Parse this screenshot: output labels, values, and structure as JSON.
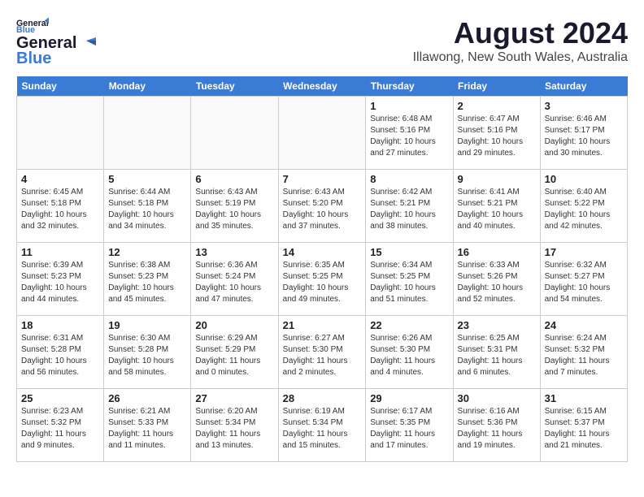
{
  "header": {
    "logo_line1": "General",
    "logo_line2": "Blue",
    "month_year": "August 2024",
    "location": "Illawong, New South Wales, Australia"
  },
  "days_of_week": [
    "Sunday",
    "Monday",
    "Tuesday",
    "Wednesday",
    "Thursday",
    "Friday",
    "Saturday"
  ],
  "weeks": [
    [
      {
        "day": "",
        "info": ""
      },
      {
        "day": "",
        "info": ""
      },
      {
        "day": "",
        "info": ""
      },
      {
        "day": "",
        "info": ""
      },
      {
        "day": "1",
        "info": "Sunrise: 6:48 AM\nSunset: 5:16 PM\nDaylight: 10 hours\nand 27 minutes."
      },
      {
        "day": "2",
        "info": "Sunrise: 6:47 AM\nSunset: 5:16 PM\nDaylight: 10 hours\nand 29 minutes."
      },
      {
        "day": "3",
        "info": "Sunrise: 6:46 AM\nSunset: 5:17 PM\nDaylight: 10 hours\nand 30 minutes."
      }
    ],
    [
      {
        "day": "4",
        "info": "Sunrise: 6:45 AM\nSunset: 5:18 PM\nDaylight: 10 hours\nand 32 minutes."
      },
      {
        "day": "5",
        "info": "Sunrise: 6:44 AM\nSunset: 5:18 PM\nDaylight: 10 hours\nand 34 minutes."
      },
      {
        "day": "6",
        "info": "Sunrise: 6:43 AM\nSunset: 5:19 PM\nDaylight: 10 hours\nand 35 minutes."
      },
      {
        "day": "7",
        "info": "Sunrise: 6:43 AM\nSunset: 5:20 PM\nDaylight: 10 hours\nand 37 minutes."
      },
      {
        "day": "8",
        "info": "Sunrise: 6:42 AM\nSunset: 5:21 PM\nDaylight: 10 hours\nand 38 minutes."
      },
      {
        "day": "9",
        "info": "Sunrise: 6:41 AM\nSunset: 5:21 PM\nDaylight: 10 hours\nand 40 minutes."
      },
      {
        "day": "10",
        "info": "Sunrise: 6:40 AM\nSunset: 5:22 PM\nDaylight: 10 hours\nand 42 minutes."
      }
    ],
    [
      {
        "day": "11",
        "info": "Sunrise: 6:39 AM\nSunset: 5:23 PM\nDaylight: 10 hours\nand 44 minutes."
      },
      {
        "day": "12",
        "info": "Sunrise: 6:38 AM\nSunset: 5:23 PM\nDaylight: 10 hours\nand 45 minutes."
      },
      {
        "day": "13",
        "info": "Sunrise: 6:36 AM\nSunset: 5:24 PM\nDaylight: 10 hours\nand 47 minutes."
      },
      {
        "day": "14",
        "info": "Sunrise: 6:35 AM\nSunset: 5:25 PM\nDaylight: 10 hours\nand 49 minutes."
      },
      {
        "day": "15",
        "info": "Sunrise: 6:34 AM\nSunset: 5:25 PM\nDaylight: 10 hours\nand 51 minutes."
      },
      {
        "day": "16",
        "info": "Sunrise: 6:33 AM\nSunset: 5:26 PM\nDaylight: 10 hours\nand 52 minutes."
      },
      {
        "day": "17",
        "info": "Sunrise: 6:32 AM\nSunset: 5:27 PM\nDaylight: 10 hours\nand 54 minutes."
      }
    ],
    [
      {
        "day": "18",
        "info": "Sunrise: 6:31 AM\nSunset: 5:28 PM\nDaylight: 10 hours\nand 56 minutes."
      },
      {
        "day": "19",
        "info": "Sunrise: 6:30 AM\nSunset: 5:28 PM\nDaylight: 10 hours\nand 58 minutes."
      },
      {
        "day": "20",
        "info": "Sunrise: 6:29 AM\nSunset: 5:29 PM\nDaylight: 11 hours\nand 0 minutes."
      },
      {
        "day": "21",
        "info": "Sunrise: 6:27 AM\nSunset: 5:30 PM\nDaylight: 11 hours\nand 2 minutes."
      },
      {
        "day": "22",
        "info": "Sunrise: 6:26 AM\nSunset: 5:30 PM\nDaylight: 11 hours\nand 4 minutes."
      },
      {
        "day": "23",
        "info": "Sunrise: 6:25 AM\nSunset: 5:31 PM\nDaylight: 11 hours\nand 6 minutes."
      },
      {
        "day": "24",
        "info": "Sunrise: 6:24 AM\nSunset: 5:32 PM\nDaylight: 11 hours\nand 7 minutes."
      }
    ],
    [
      {
        "day": "25",
        "info": "Sunrise: 6:23 AM\nSunset: 5:32 PM\nDaylight: 11 hours\nand 9 minutes."
      },
      {
        "day": "26",
        "info": "Sunrise: 6:21 AM\nSunset: 5:33 PM\nDaylight: 11 hours\nand 11 minutes."
      },
      {
        "day": "27",
        "info": "Sunrise: 6:20 AM\nSunset: 5:34 PM\nDaylight: 11 hours\nand 13 minutes."
      },
      {
        "day": "28",
        "info": "Sunrise: 6:19 AM\nSunset: 5:34 PM\nDaylight: 11 hours\nand 15 minutes."
      },
      {
        "day": "29",
        "info": "Sunrise: 6:17 AM\nSunset: 5:35 PM\nDaylight: 11 hours\nand 17 minutes."
      },
      {
        "day": "30",
        "info": "Sunrise: 6:16 AM\nSunset: 5:36 PM\nDaylight: 11 hours\nand 19 minutes."
      },
      {
        "day": "31",
        "info": "Sunrise: 6:15 AM\nSunset: 5:37 PM\nDaylight: 11 hours\nand 21 minutes."
      }
    ]
  ]
}
